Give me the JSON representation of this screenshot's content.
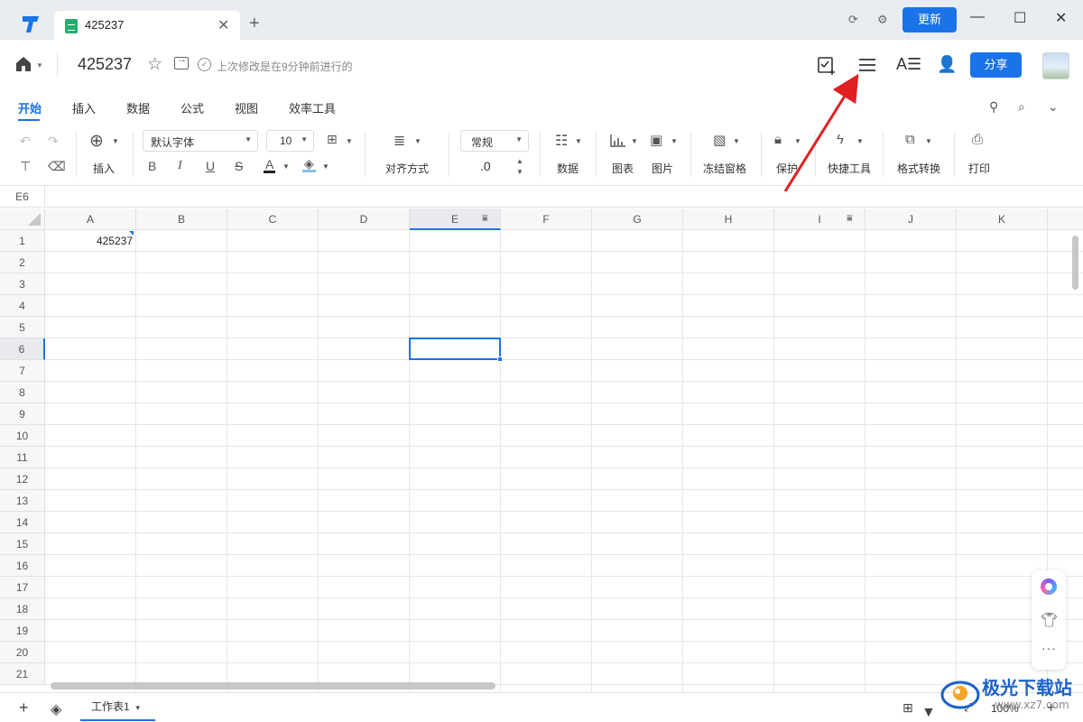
{
  "titlebar": {
    "tab_title": "425237",
    "tab_close": "✕",
    "tab_add": "+",
    "update_label": "更新",
    "win_minimize": "—",
    "win_maximize": "☐",
    "win_close": "✕"
  },
  "docbar": {
    "title": "425237",
    "saved_status": "上次修改是在9分钟前进行的",
    "share_label": "分享"
  },
  "menu": {
    "tabs": [
      "开始",
      "插入",
      "数据",
      "公式",
      "视图",
      "效率工具"
    ],
    "active": "开始"
  },
  "toolbar": {
    "insert_label": "插入",
    "font_name": "默认字体",
    "font_size": "10",
    "align_label": "对齐方式",
    "number_format": "常规",
    "decimal_label": ".0",
    "data_label": "数据",
    "chart_label": "图表",
    "image_label": "图片",
    "freeze_label": "冻结窗格",
    "protect_label": "保护",
    "quicktools_label": "快捷工具",
    "convert_label": "格式转换",
    "print_label": "打印",
    "bold": "B",
    "italic": "I",
    "underline": "U",
    "strike": "S",
    "font_color": "A"
  },
  "formula_bar": {
    "cell_ref": "E6"
  },
  "sheet": {
    "columns": [
      "A",
      "B",
      "C",
      "D",
      "E",
      "F",
      "G",
      "H",
      "I",
      "J",
      "K"
    ],
    "rows": [
      "1",
      "2",
      "3",
      "4",
      "5",
      "6",
      "7",
      "8",
      "9",
      "10",
      "11",
      "12",
      "13",
      "14",
      "15",
      "16",
      "17",
      "18",
      "19",
      "20",
      "21"
    ],
    "selected_col": "E",
    "selected_row": "6",
    "cell_a1": "425237"
  },
  "bottombar": {
    "sheet_name": "工作表1",
    "zoom": "100%"
  },
  "watermark": {
    "text": "极光下载站",
    "url": "www.xz7.com"
  },
  "colors": {
    "accent": "#1a73e8",
    "annotation_arrow": "#e02020",
    "sheet_icon": "#1fae6b"
  }
}
